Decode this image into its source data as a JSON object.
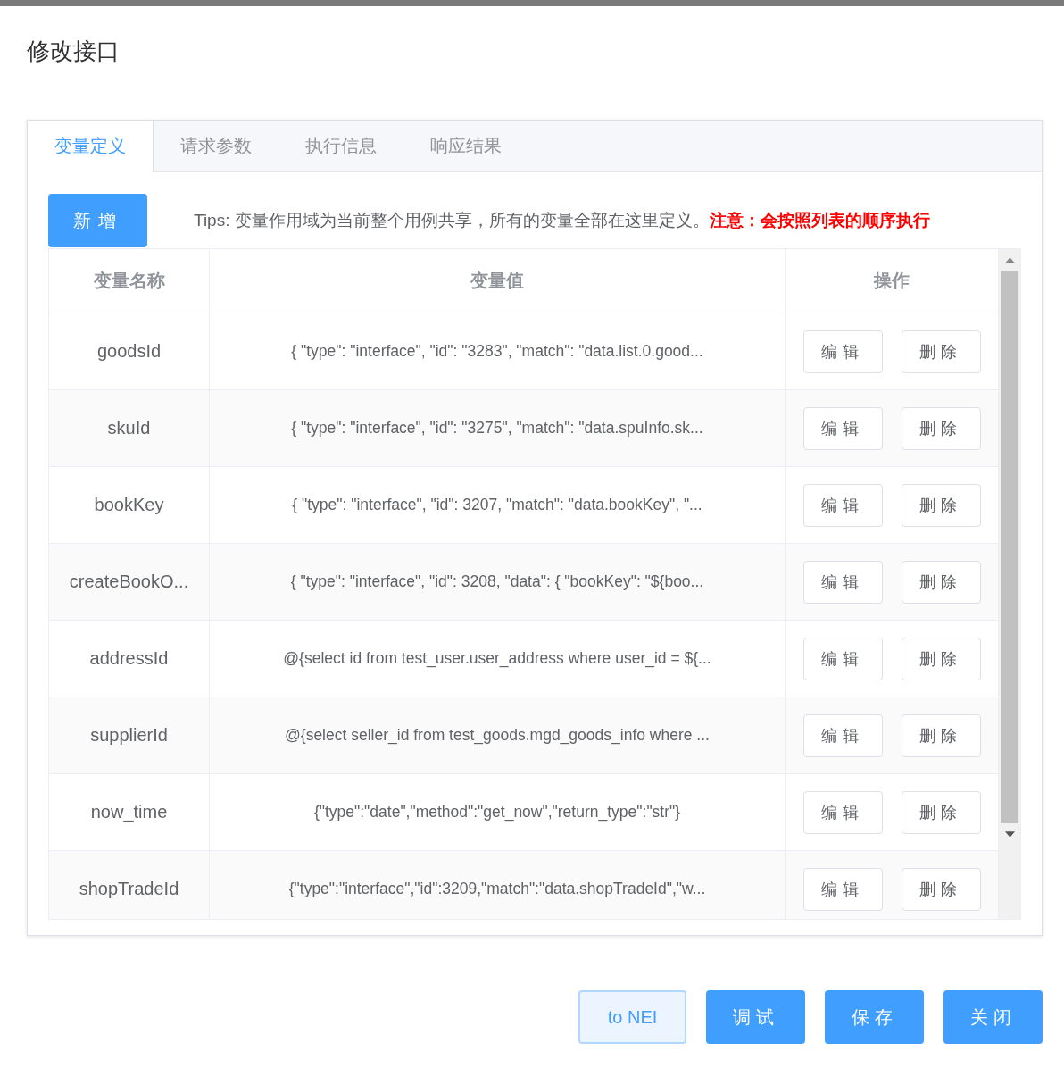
{
  "dialog": {
    "title": "修改接口"
  },
  "tabs": [
    {
      "label": "变量定义",
      "selected": true
    },
    {
      "label": "请求参数",
      "selected": false
    },
    {
      "label": "执行信息",
      "selected": false
    },
    {
      "label": "响应结果",
      "selected": false
    }
  ],
  "add_button": "新增",
  "tips": {
    "text": "Tips: 变量作用域为当前整个用例共享，所有的变量全部在这里定义。",
    "warning": "注意：会按照列表的顺序执行"
  },
  "table": {
    "columns": [
      "变量名称",
      "变量值",
      "操作"
    ],
    "rows": [
      {
        "name": "goodsId",
        "value": "{ \"type\": \"interface\", \"id\": \"3283\", \"match\": \"data.list.0.good...",
        "actions": [
          "编辑",
          "删除"
        ]
      },
      {
        "name": "skuId",
        "value": "{ \"type\": \"interface\", \"id\": \"3275\", \"match\": \"data.spuInfo.sk...",
        "actions": [
          "编辑",
          "删除"
        ]
      },
      {
        "name": "bookKey",
        "value": "{ \"type\": \"interface\", \"id\": 3207, \"match\": \"data.bookKey\", \"...",
        "actions": [
          "编辑",
          "删除"
        ]
      },
      {
        "name": "createBookO...",
        "value": "{ \"type\": \"interface\", \"id\": 3208, \"data\": { \"bookKey\": \"${boo...",
        "actions": [
          "编辑",
          "删除"
        ]
      },
      {
        "name": "addressId",
        "value": "@{select id from test_user.user_address where user_id = ${...",
        "actions": [
          "编辑",
          "删除"
        ]
      },
      {
        "name": "supplierId",
        "value": "@{select seller_id from test_goods.mgd_goods_info where ...",
        "actions": [
          "编辑",
          "删除"
        ]
      },
      {
        "name": "now_time",
        "value": "{\"type\":\"date\",\"method\":\"get_now\",\"return_type\":\"str\"}",
        "actions": [
          "编辑",
          "删除"
        ]
      },
      {
        "name": "shopTradeId",
        "value": "{\"type\":\"interface\",\"id\":3209,\"match\":\"data.shopTradeId\",\"w...",
        "actions": [
          "编辑",
          "删除"
        ]
      }
    ]
  },
  "footer_buttons": [
    {
      "label": "to NEI",
      "kind": "plain"
    },
    {
      "label": "调试",
      "kind": "primary"
    },
    {
      "label": "保存",
      "kind": "primary"
    },
    {
      "label": "关闭",
      "kind": "primary"
    }
  ]
}
